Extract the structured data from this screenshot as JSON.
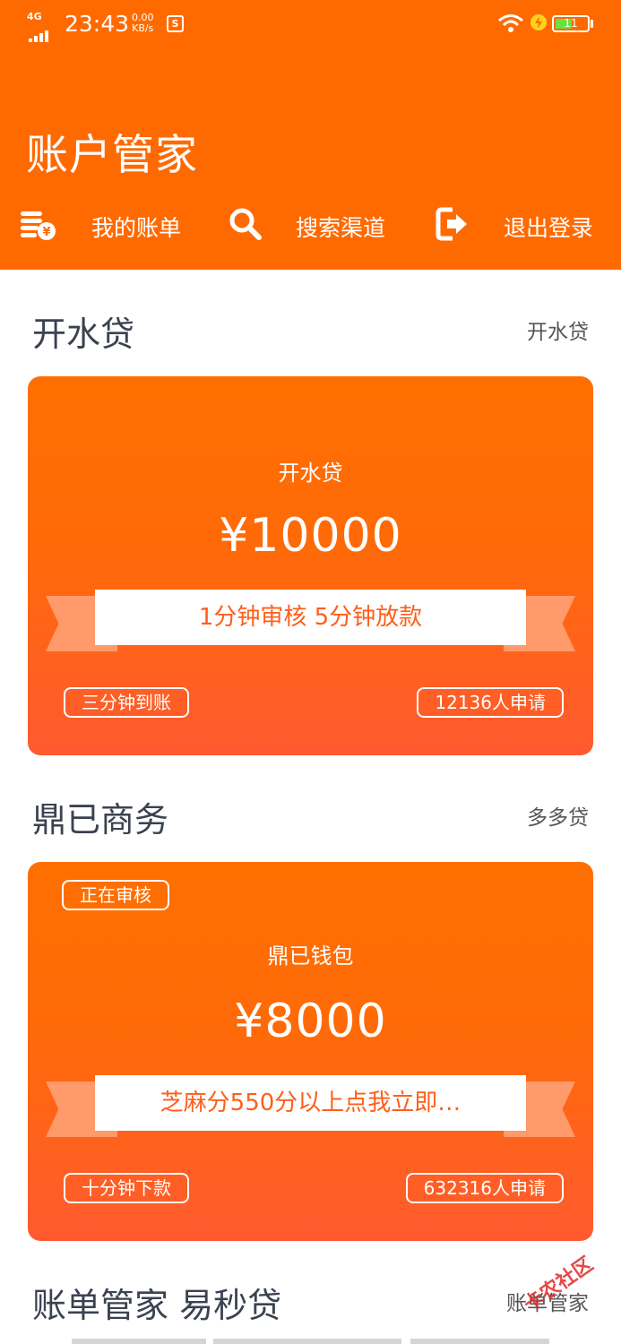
{
  "status_bar": {
    "network": "4G",
    "time": "23:43",
    "speed_value": "0.00",
    "speed_unit": "KB/s",
    "sim_badge": "S",
    "battery": "11"
  },
  "header": {
    "title": "账户管家",
    "nav": [
      {
        "label": "我的账单",
        "icon": "bill-coins-icon"
      },
      {
        "label": "搜索渠道",
        "icon": "search-icon"
      },
      {
        "label": "退出登录",
        "icon": "logout-icon"
      }
    ]
  },
  "sections": [
    {
      "title": "开水贷",
      "link": "开水贷",
      "card": {
        "status": "",
        "name": "开水贷",
        "amount": "¥10000",
        "slogan": "1分钟审核  5分钟放款",
        "left_tag": "三分钟到账",
        "right_tag": "12136人申请"
      }
    },
    {
      "title": "鼎已商务",
      "link": "多多贷",
      "card": {
        "status": "正在审核",
        "name": "鼎已钱包",
        "amount": "¥8000",
        "slogan": "芝麻分550分以上点我立即…",
        "left_tag": "十分钟下款",
        "right_tag": "632316人申请"
      }
    },
    {
      "title": "账单管家 易秒贷",
      "link": "账单管家"
    }
  ],
  "watermark": "卡农社区",
  "colors": {
    "brand_orange": "#ff6a00",
    "card_gradient_end": "#ff5a30",
    "heading_text": "#3b4250"
  }
}
